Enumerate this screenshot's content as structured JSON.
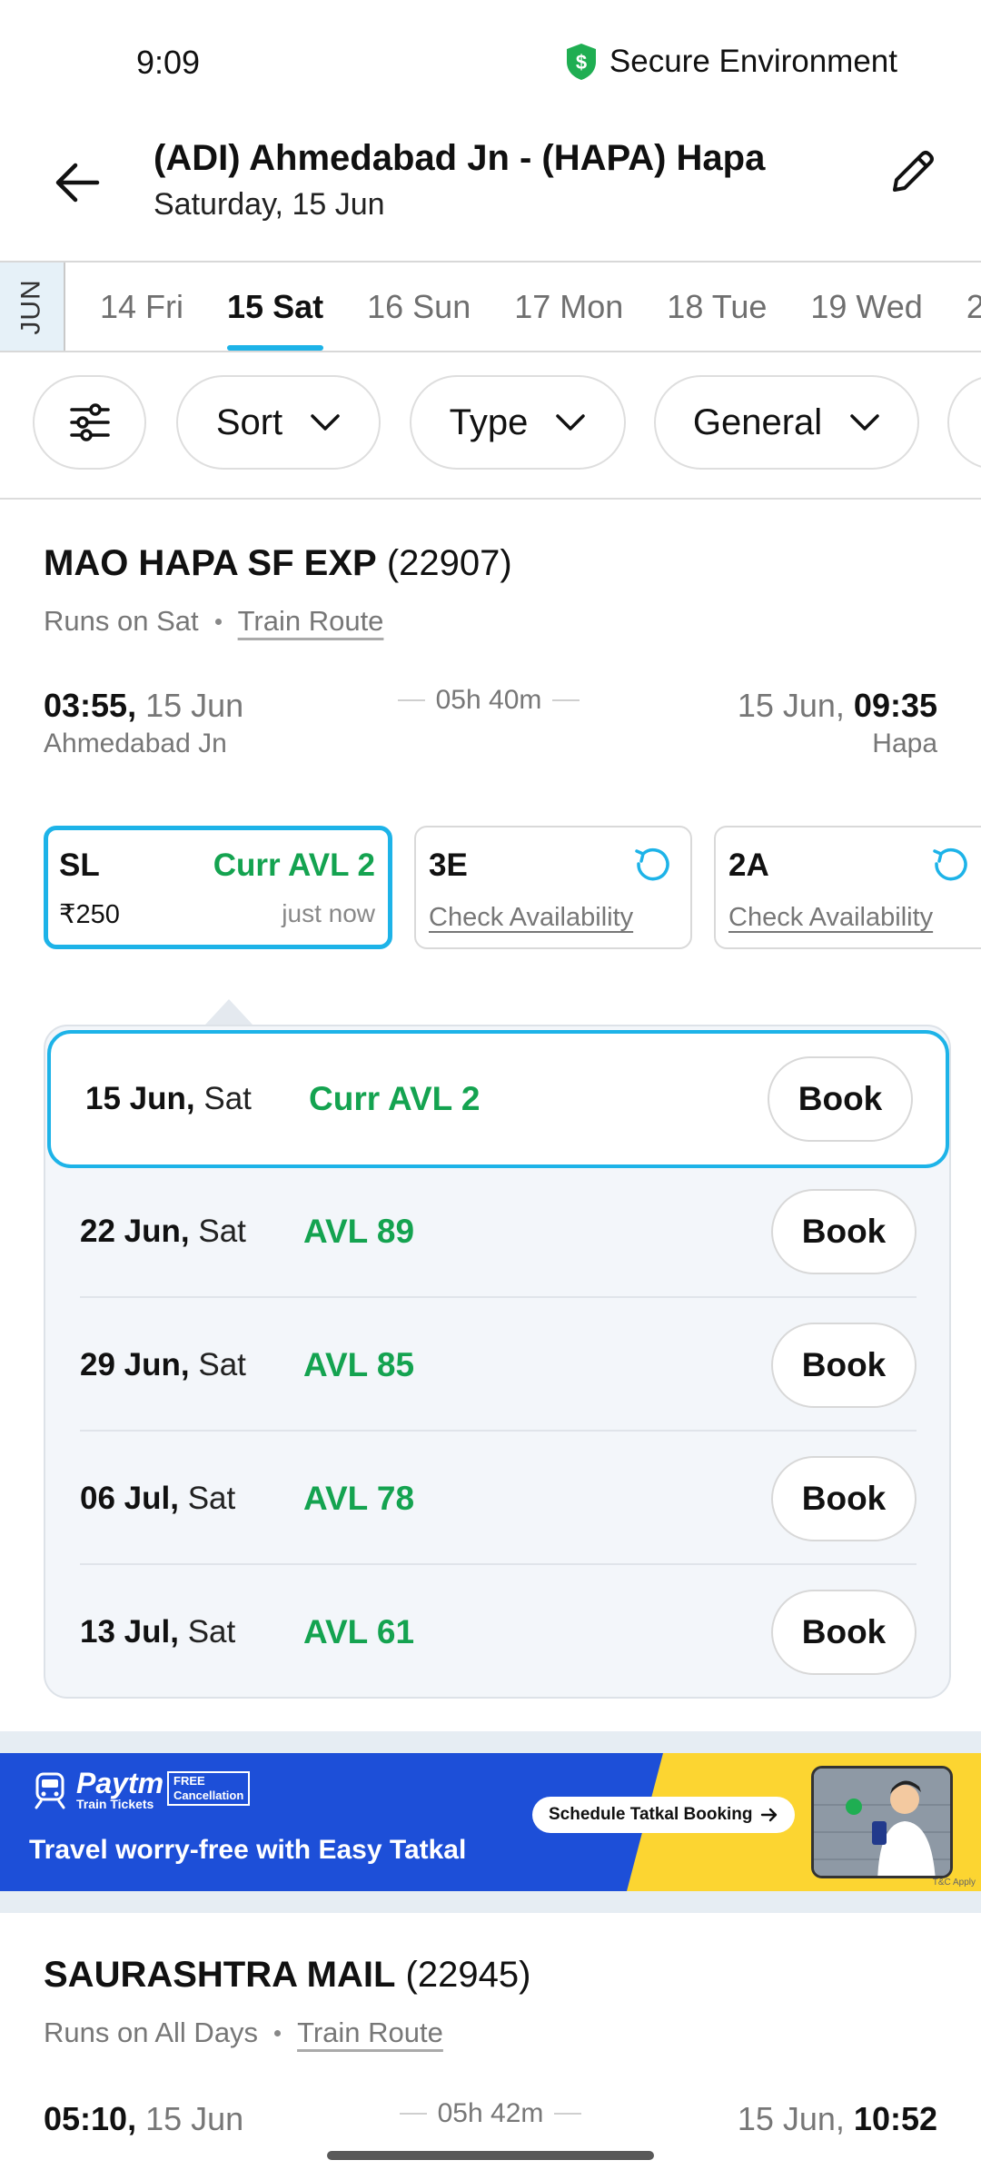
{
  "status_bar": {
    "time": "9:09",
    "secure_label": "Secure Environment"
  },
  "header": {
    "title": "(ADI) Ahmedabad Jn - (HAPA) Hapa",
    "date": "Saturday, 15 Jun"
  },
  "date_strip": {
    "month": "JUN",
    "dates": [
      "14 Fri",
      "15 Sat",
      "16 Sun",
      "17 Mon",
      "18 Tue",
      "19 Wed",
      "2"
    ],
    "active_index": 1
  },
  "filters": {
    "sort": "Sort",
    "type": "Type",
    "quota": "General"
  },
  "train1": {
    "name": "MAO HAPA SF EXP",
    "number": "(22907)",
    "runs": "Runs on Sat",
    "route_link": "Train Route",
    "dep_time": "03:55,",
    "dep_date": "15 Jun",
    "dep_station": "Ahmedabad Jn",
    "duration": "05h 40m",
    "arr_date": "15 Jun,",
    "arr_time": "09:35",
    "arr_station": "Hapa",
    "classes": [
      {
        "code": "SL",
        "availability": "Curr AVL 2",
        "price": "₹250",
        "updated": "just now"
      },
      {
        "code": "3E",
        "check": "Check Availability"
      },
      {
        "code": "2A",
        "check": "Check Availability"
      }
    ],
    "availability": [
      {
        "date": "15 Jun,",
        "day": "Sat",
        "status": "Curr AVL 2",
        "action": "Book"
      },
      {
        "date": "22 Jun,",
        "day": "Sat",
        "status": "AVL 89",
        "action": "Book"
      },
      {
        "date": "29 Jun,",
        "day": "Sat",
        "status": "AVL 85",
        "action": "Book"
      },
      {
        "date": "06 Jul,",
        "day": "Sat",
        "status": "AVL 78",
        "action": "Book"
      },
      {
        "date": "13 Jul,",
        "day": "Sat",
        "status": "AVL 61",
        "action": "Book"
      }
    ]
  },
  "banner": {
    "brand": "Paytm",
    "brand_sub": "Train Tickets",
    "badge_line1": "FREE",
    "badge_line2": "Cancellation",
    "tagline": "Travel worry-free with Easy Tatkal",
    "cta": "Schedule Tatkal Booking",
    "tc": "T&C Apply"
  },
  "train2": {
    "name": "SAURASHTRA MAIL",
    "number": "(22945)",
    "runs": "Runs on All Days",
    "route_link": "Train Route",
    "dep_time": "05:10,",
    "dep_date": "15 Jun",
    "duration": "05h 42m",
    "arr_date": "15 Jun,",
    "arr_time": "10:52"
  },
  "colors": {
    "accent": "#1db3e8",
    "available": "#14a350",
    "banner_blue": "#1d4fd8",
    "banner_yellow": "#fcd531"
  }
}
